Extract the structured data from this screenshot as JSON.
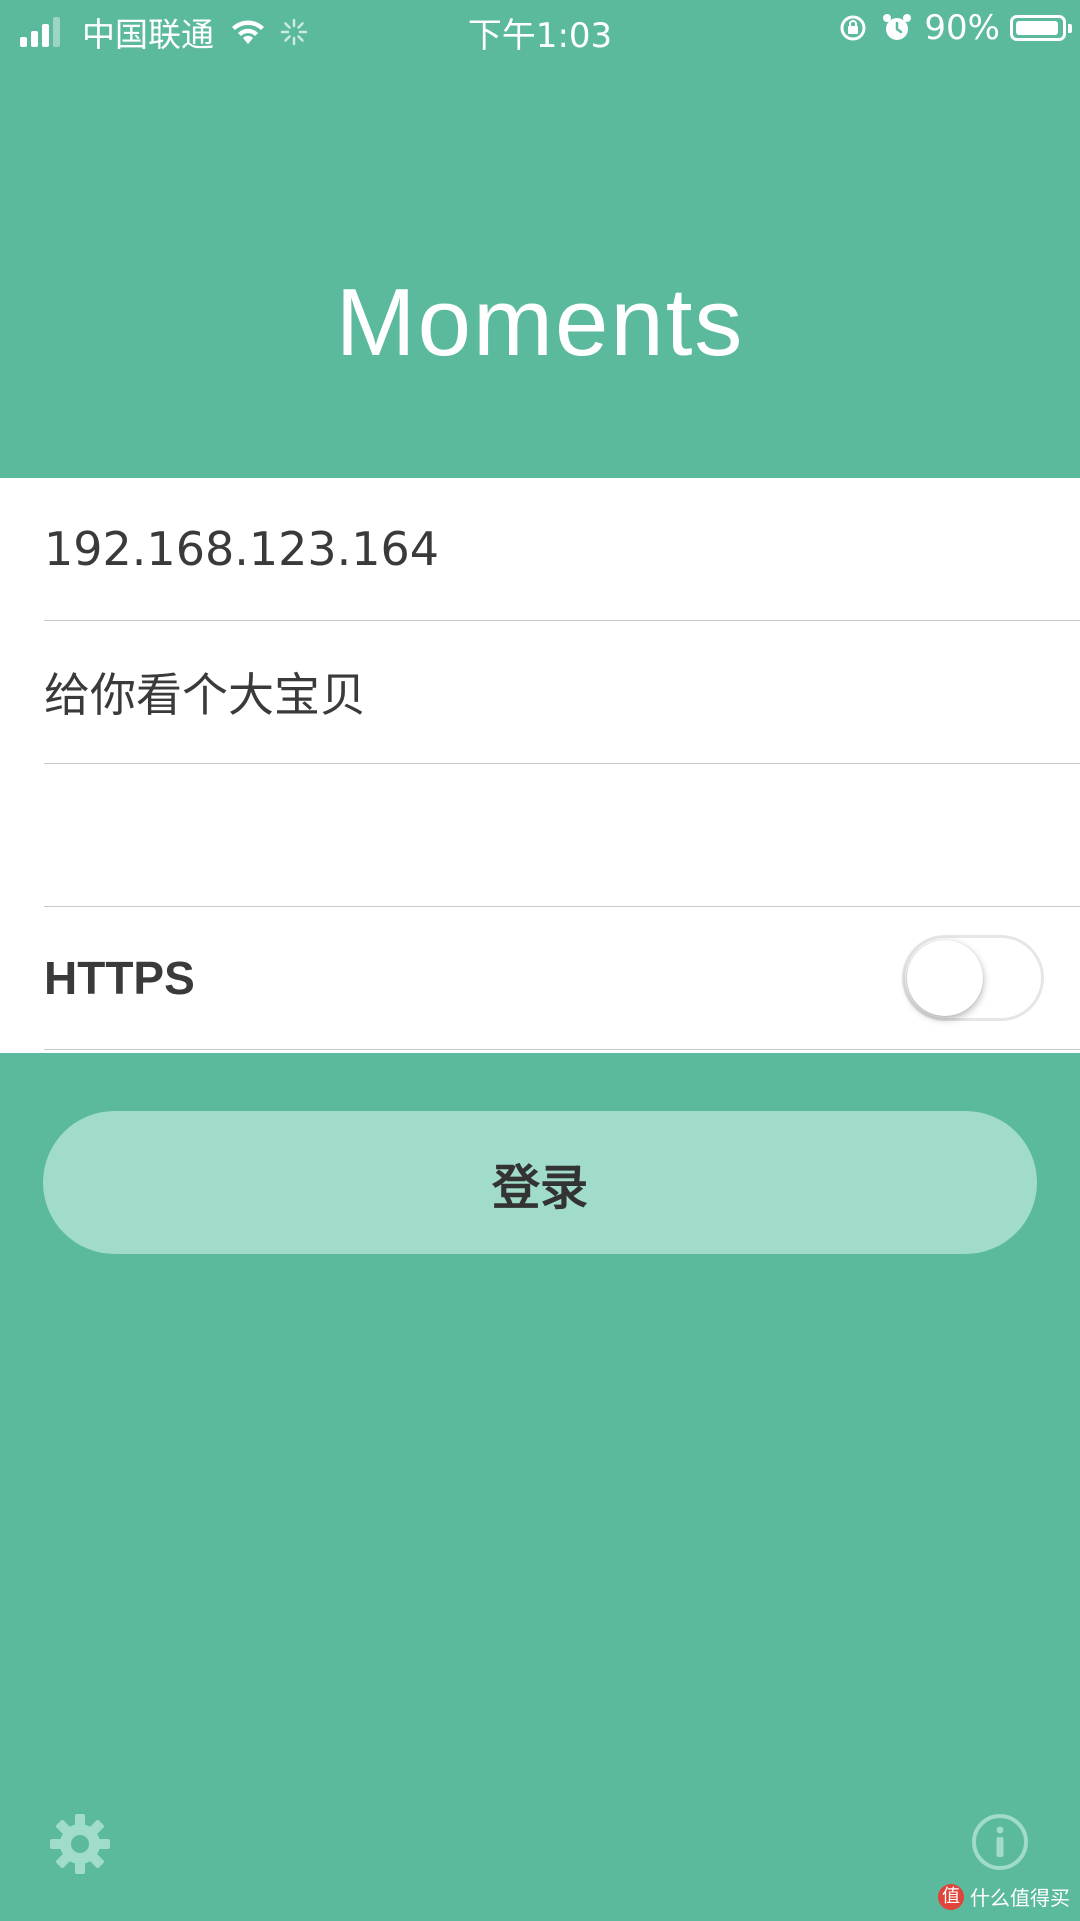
{
  "status_bar": {
    "carrier": "中国联通",
    "time": "下午1:03",
    "battery": "90%"
  },
  "app": {
    "title": "Moments"
  },
  "form": {
    "server_value": "192.168.123.164",
    "username_value": "给你看个大宝贝",
    "password_value": "",
    "https_label": "HTTPS",
    "https_enabled": false
  },
  "login_button_label": "登录",
  "watermark": "什么值得买",
  "colors": {
    "background": "#5bba9d",
    "button": "#a0dbcb",
    "form_bg": "#ffffff"
  },
  "icons": {
    "bottom_left": "gear-icon",
    "bottom_right": "info-icon"
  }
}
